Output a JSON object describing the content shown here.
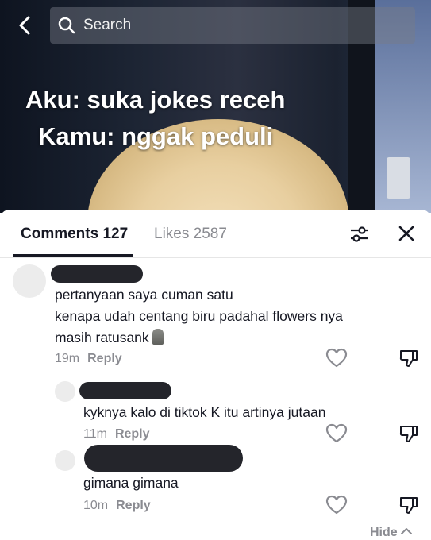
{
  "search": {
    "placeholder": "Search"
  },
  "video": {
    "caption_line1": "Aku: suka jokes receh",
    "caption_line2": "Kamu: nggak peduli"
  },
  "tabs": {
    "comments_label": "Comments 127",
    "likes_label": "Likes 2587"
  },
  "comments": [
    {
      "text_line1": "pertanyaan saya cuman satu",
      "text_line2": "kenapa udah centang biru padahal flowers nya",
      "text_line3": "masih ratusank",
      "emoji_icon": "moai-icon",
      "time": "19m",
      "reply_label": "Reply"
    }
  ],
  "replies": [
    {
      "text": "kyknya kalo di tiktok K itu artinya jutaan",
      "time": "11m",
      "reply_label": "Reply"
    },
    {
      "text": "gimana gimana",
      "time": "10m",
      "reply_label": "Reply"
    }
  ],
  "hide_label": "Hide",
  "colors": {
    "primary_text": "#161823",
    "secondary_text": "#8a8b91",
    "redaction": "#24252b"
  }
}
